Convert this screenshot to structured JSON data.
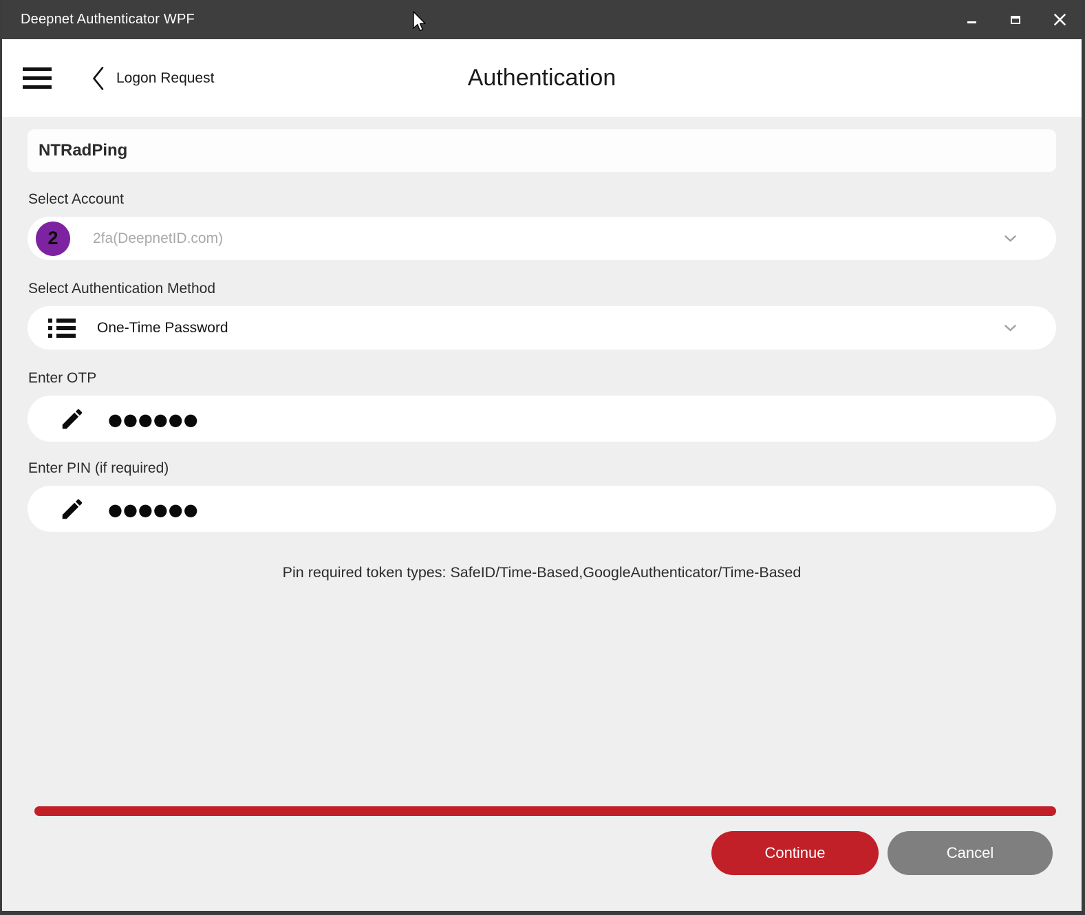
{
  "window": {
    "title": "Deepnet Authenticator WPF"
  },
  "header": {
    "back_label": "Logon Request",
    "title": "Authentication"
  },
  "main": {
    "app_name": "NTRadPing",
    "account": {
      "label": "Select Account",
      "badge": "2",
      "selected": "2fa(DeepnetID.com)"
    },
    "method": {
      "label": "Select Authentication Method",
      "selected": "One-Time Password"
    },
    "otp": {
      "label": "Enter OTP",
      "masked_value": "●●●●●●"
    },
    "pin": {
      "label": "Enter PIN (if required)",
      "masked_value": "●●●●●●"
    },
    "note": "Pin required token types: SafeID/Time-Based,GoogleAuthenticator/Time-Based"
  },
  "footer": {
    "progress_percent": 100,
    "continue_label": "Continue",
    "cancel_label": "Cancel"
  },
  "colors": {
    "titlebar": "#3e3e3e",
    "frame": "#3c3c3c",
    "content_bg": "#efefef",
    "accent_red": "#c12028",
    "badge_purple": "#7d23a1",
    "cancel_gray": "#7f7f7f"
  }
}
